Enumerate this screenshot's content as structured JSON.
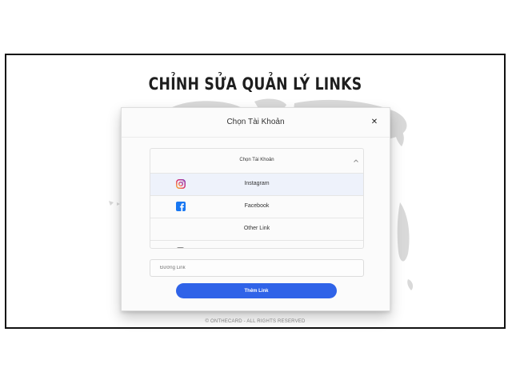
{
  "page": {
    "title": "CHỈNH SỬA QUẢN LÝ LINKS"
  },
  "footer": {
    "text": "©  ONTHECARD - ALL RIGHTS RESERVED"
  },
  "modal": {
    "title": "Chọn Tài Khoản",
    "close_icon": "close-icon",
    "select": {
      "placeholder": "Chọn Tài Khoản",
      "options": [
        {
          "label": "Instagram",
          "icon": "instagram-icon",
          "highlighted": true
        },
        {
          "label": "Facebook",
          "icon": "facebook-icon",
          "highlighted": false
        },
        {
          "label": "Other Link",
          "icon": "",
          "highlighted": false
        }
      ]
    },
    "link_input": {
      "placeholder": "Đường Link",
      "value": ""
    },
    "add_button": {
      "label": "Thêm Link"
    }
  },
  "colors": {
    "accent": "#2f63e8",
    "facebook": "#1877f2",
    "highlight": "#eef2fb"
  }
}
